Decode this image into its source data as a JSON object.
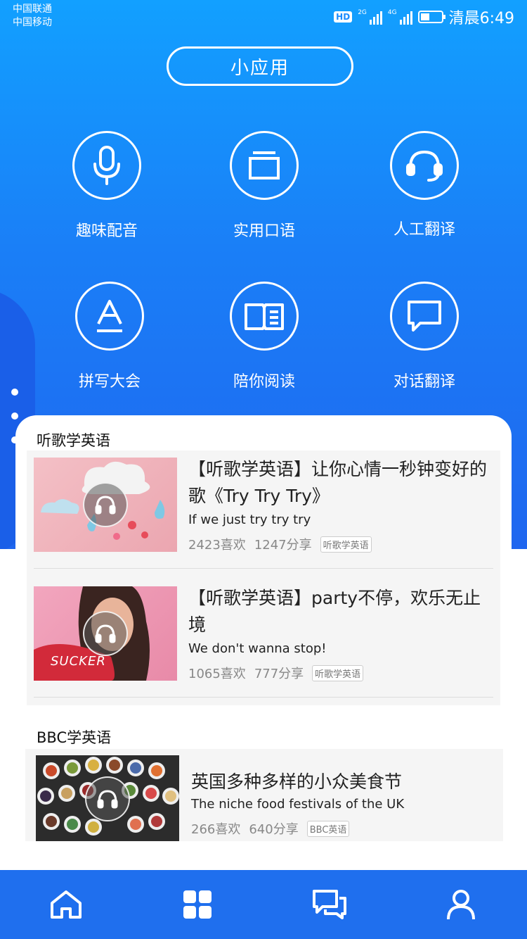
{
  "status": {
    "carrier1": "中国联通",
    "carrier2": "中国移动",
    "hd": "HD",
    "net1": "2G",
    "net2": "4G",
    "time": "清晨6:49"
  },
  "header": {
    "title": "小应用"
  },
  "apps": [
    {
      "label": "趣味配音",
      "icon": "microphone-icon"
    },
    {
      "label": "实用口语",
      "icon": "window-icon"
    },
    {
      "label": "人工翻译",
      "icon": "headset-icon"
    },
    {
      "label": "拼写大会",
      "icon": "letter-a-icon"
    },
    {
      "label": "陪你阅读",
      "icon": "book-icon"
    },
    {
      "label": "对话翻译",
      "icon": "chat-bubble-icon"
    }
  ],
  "song_section": {
    "title": "听歌学英语",
    "items": [
      {
        "title": "【听歌学英语】让你心情一秒钟变好的歌《Try Try Try》",
        "subtitle": "If we just try try try",
        "likes": "2423喜欢",
        "shares": "1247分享",
        "tag": "听歌学英语"
      },
      {
        "title": "【听歌学英语】party不停，欢乐无止境",
        "subtitle": "We don't wanna stop!",
        "likes": "1065喜欢",
        "shares": "777分享",
        "tag": "听歌学英语",
        "thumb_text": "SUCKER"
      }
    ]
  },
  "bbc_section": {
    "title": "BBC学英语",
    "items": [
      {
        "title": "英国多种多样的小众美食节",
        "subtitle": "The niche food festivals of the UK",
        "likes": "266喜欢",
        "shares": "640分享",
        "tag": "BBC英语"
      }
    ]
  },
  "nav": [
    {
      "icon": "home-icon"
    },
    {
      "icon": "apps-grid-icon"
    },
    {
      "icon": "chat-icon"
    },
    {
      "icon": "profile-icon"
    }
  ],
  "colors": {
    "primary": "#1f6fee",
    "gradient_top": "#12a0ff"
  }
}
